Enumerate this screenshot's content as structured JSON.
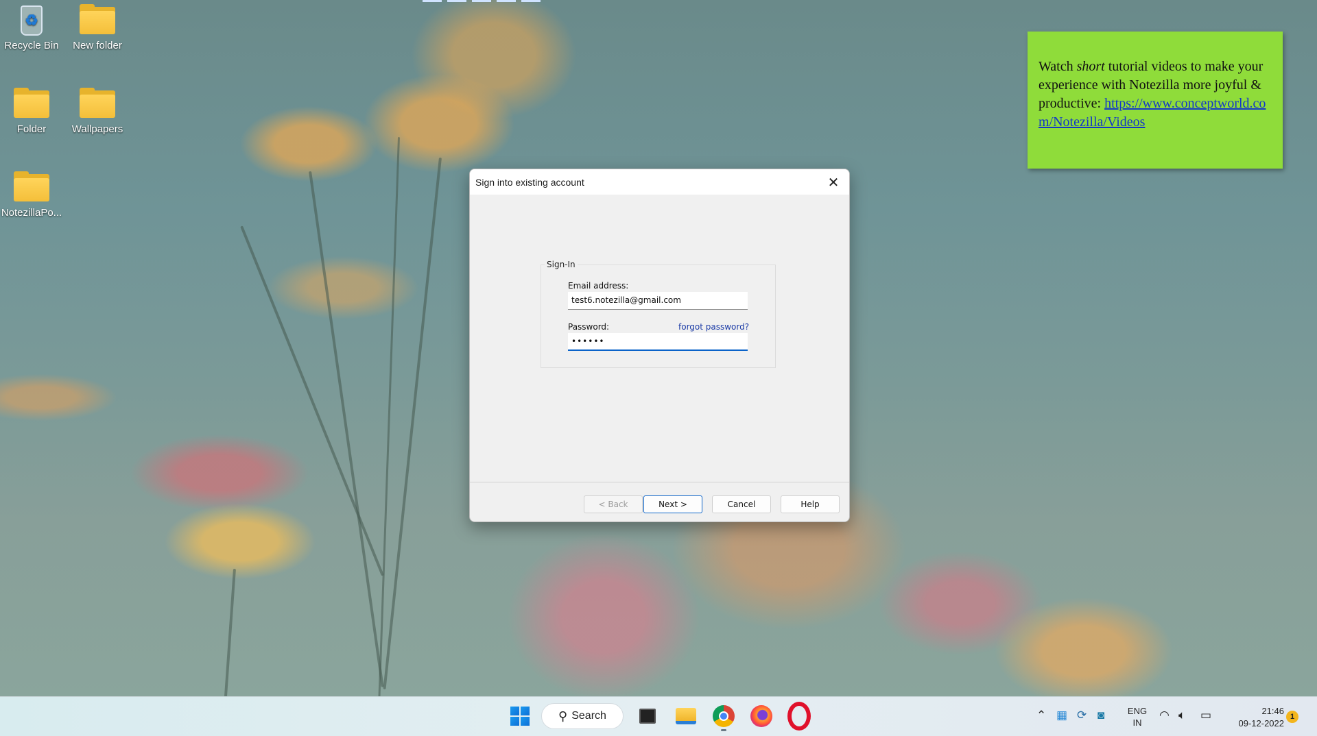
{
  "desktop": {
    "icons": [
      {
        "label": "Recycle Bin",
        "icon": "recycle-bin-icon"
      },
      {
        "label": "New folder",
        "icon": "folder-icon"
      },
      {
        "label": "Folder",
        "icon": "folder-icon"
      },
      {
        "label": "Wallpapers",
        "icon": "folder-icon"
      },
      {
        "label": "NotezillaPo...",
        "icon": "folder-icon"
      }
    ]
  },
  "sticky_note": {
    "text_before": "Watch ",
    "text_em": "short",
    "text_after": " tutorial videos to make your experience with Notezilla more joyful & productive: ",
    "link": "https://www.conceptworld.com/Notezilla/Videos",
    "color": "#8fdc3a"
  },
  "dialog": {
    "title": "Sign into existing account",
    "group_label": "Sign-In",
    "email_label": "Email address:",
    "email_value": "test6.notezilla@gmail.com",
    "password_label": "Password:",
    "password_value": "••••••",
    "forgot_link": "forgot password?",
    "buttons": {
      "back": "< Back",
      "next": "Next >",
      "cancel": "Cancel",
      "help": "Help"
    },
    "accent": "#0a63c9"
  },
  "taskbar": {
    "search_label": "Search",
    "apps": [
      "task-view",
      "file-explorer",
      "chrome",
      "firefox",
      "opera"
    ],
    "language": {
      "line1": "ENG",
      "line2": "IN"
    },
    "clock": {
      "time": "21:46",
      "date": "09-12-2022"
    },
    "notification_count": "1"
  }
}
